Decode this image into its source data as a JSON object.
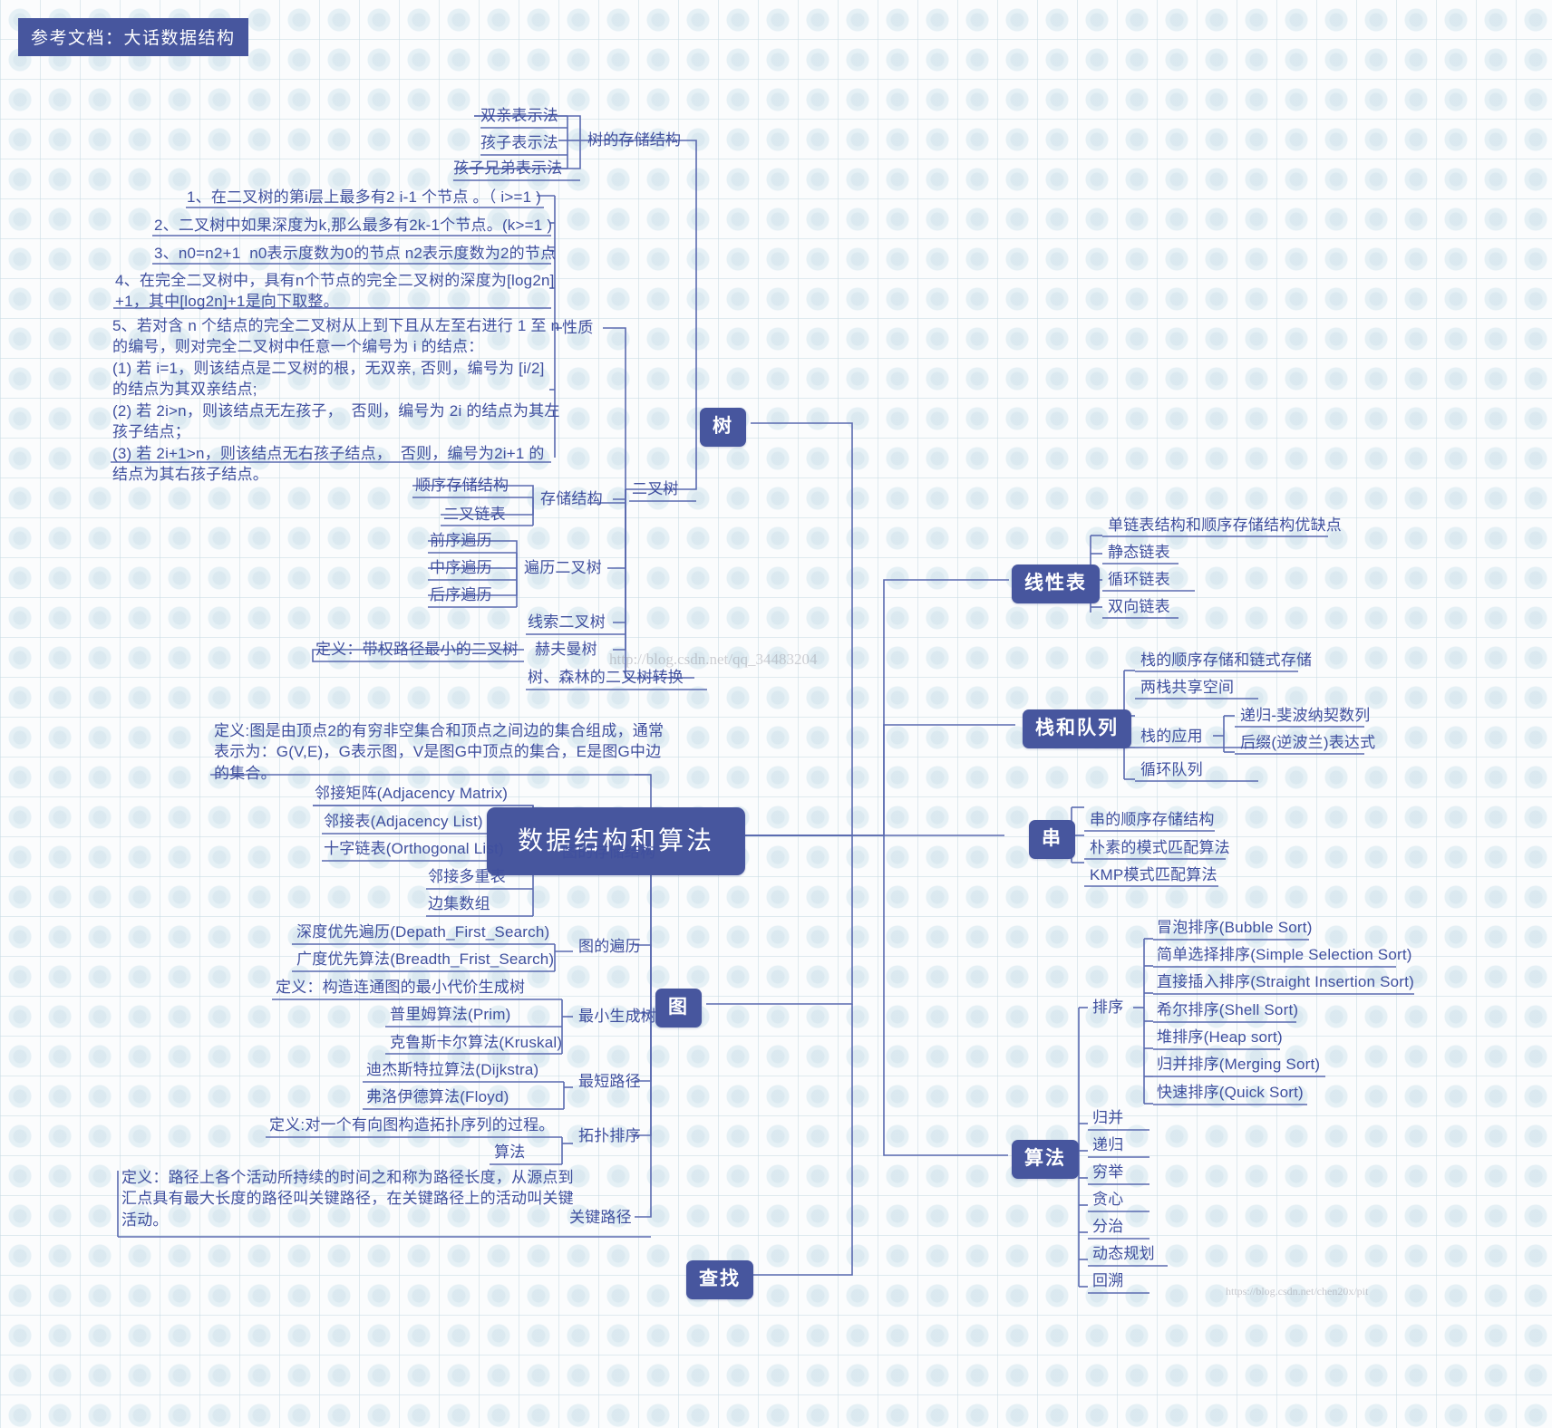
{
  "banner": {
    "label": "参考文档：大话数据结构"
  },
  "center": {
    "label": "数据结构和算法"
  },
  "colors": {
    "accent": "#47569e",
    "text": "#3f4f9e",
    "line": "#5a6ab0",
    "background": "#fbfcfd"
  },
  "watermarks": {
    "middle": "http://blog.csdn.net/qq_34483204",
    "bottom": "https://blog.csdn.net/chen20x/pit"
  },
  "branches": {
    "tree": {
      "label": "树",
      "children": {
        "storage": {
          "label": "树的存储结构",
          "items": [
            "双亲表示法",
            "孩子表示法",
            "孩子兄弟表示法"
          ]
        },
        "binary_tree": {
          "label": "二叉树",
          "properties": {
            "label": "性质",
            "items": [
              "1、在二叉树的第i层上最多有2 i-1 个节点 。（ i>=1 )",
              "2、二叉树中如果深度为k,那么最多有2k-1个节点。(k>=1 )",
              "3、n0=n2+1  n0表示度数为0的节点 n2表示度数为2的节点",
              "4、在完全二叉树中，具有n个节点的完全二叉树的深度为[log2n]\n+1，其中[log2n]+1是向下取整。",
              "5、若对含 n 个结点的完全二叉树从上到下且从左至右进行 1 至 n\n的编号，则对完全二叉树中任意一个编号为 i 的结点：\n(1) 若 i=1，则该结点是二叉树的根，无双亲, 否则，编号为 [i/2]\n的结点为其双亲结点;\n(2) 若 2i>n，则该结点无左孩子，  否则，编号为 2i 的结点为其左\n孩子结点；\n(3) 若 2i+1>n，则该结点无右孩子结点，  否则，编号为2i+1 的\n结点为其右孩子结点。"
            ]
          },
          "storage_structure": {
            "label": "存储结构",
            "items": [
              "顺序存储结构",
              "二叉链表"
            ]
          },
          "traversal": {
            "label": "遍历二叉树",
            "items": [
              "前序遍历",
              "中序遍历",
              "后序遍历"
            ]
          },
          "threaded": {
            "label": "线索二叉树"
          },
          "huffman": {
            "label": "赫夫曼树",
            "definition": "定义：带权路径最小的二叉树"
          },
          "convert": {
            "label": "树、森林的二叉树转换"
          }
        }
      }
    },
    "graph": {
      "label": "图",
      "definition": "定义:图是由顶点2的有穷非空集合和顶点之间边的集合组成，通常\n表示为：G(V,E)，G表示图，V是图G中顶点的集合，E是图G中边\n的集合。",
      "storage": {
        "label": "图的存储结构",
        "items": [
          "邻接矩阵(Adjacency Matrix)",
          "邻接表(Adjacency List)",
          "十字链表(Orthogonal List)",
          "邻接多重表",
          "边集数组"
        ]
      },
      "traversal": {
        "label": "图的遍历",
        "items": [
          "深度优先遍历(Depath_First_Search)",
          "广度优先算法(Breadth_Frist_Search)"
        ]
      },
      "mst": {
        "label": "最小生成树",
        "definition": "定义：构造连通图的最小代价生成树",
        "items": [
          "普里姆算法(Prim)",
          "克鲁斯卡尔算法(Kruskal)"
        ]
      },
      "shortest_path": {
        "label": "最短路径",
        "items": [
          "迪杰斯特拉算法(Dijkstra)",
          "弗洛伊德算法(Floyd)"
        ]
      },
      "topo": {
        "label": "拓扑排序",
        "definition": "定义:对一个有向图构造拓扑序列的过程。",
        "items": [
          "算法"
        ]
      },
      "critical_path": {
        "label": "关键路径",
        "definition": "定义：路径上各个活动所持续的时间之和称为路径长度，从源点到\n汇点具有最大长度的路径叫关键路径，在关键路径上的活动叫关键\n活动。"
      }
    },
    "search": {
      "label": "查找"
    },
    "linear_list": {
      "label": "线性表",
      "items": [
        "单链表结构和顺序存储结构优缺点",
        "静态链表",
        "循环链表",
        "双向链表"
      ]
    },
    "stack_queue": {
      "label": "栈和队列",
      "items": [
        "栈的顺序存储和链式存储",
        "两栈共享空间",
        "栈的应用",
        "循环队列"
      ],
      "stack_app": {
        "label": "栈的应用",
        "items": [
          "递归-斐波纳契数列",
          "后缀(逆波兰)表达式"
        ]
      }
    },
    "string": {
      "label": "串",
      "items": [
        "串的顺序存储结构",
        "朴素的模式匹配算法",
        "KMP模式匹配算法"
      ]
    },
    "algorithm": {
      "label": "算法",
      "sorting": {
        "label": "排序",
        "items": [
          "冒泡排序(Bubble Sort)",
          "简单选择排序(Simple Selection Sort)",
          "直接插入排序(Straight Insertion Sort)",
          "希尔排序(Shell Sort)",
          "堆排序(Heap sort)",
          "归并排序(Merging Sort)",
          "快速排序(Quick Sort)"
        ]
      },
      "items": [
        "归并",
        "递归",
        "穷举",
        "贪心",
        "分治",
        "动态规划",
        "回溯"
      ]
    }
  }
}
